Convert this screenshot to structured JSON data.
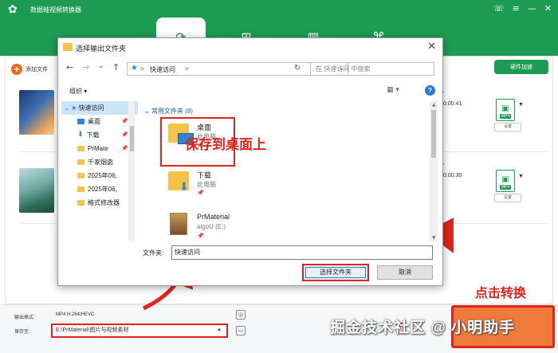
{
  "app": {
    "title": "数据蛙视频转换器",
    "logo_icon": "✿",
    "window_controls": [
      "☏",
      "≡",
      "—",
      "✕"
    ],
    "tabs": [
      {
        "name": "convert",
        "icon": "⟳"
      },
      {
        "name": "edit",
        "icon": "⊞"
      },
      {
        "name": "layout",
        "icon": "▥"
      },
      {
        "name": "toolbox",
        "icon": "⌘"
      }
    ],
    "add_file_label": "添加文件",
    "hw_accel_label": "硬件加速",
    "rows": [
      {
        "duration": "00:00:41",
        "format_tag": "MP4",
        "settings_label": "设置"
      },
      {
        "duration": "00:00:30",
        "format_tag": "MP4",
        "settings_label": "设置"
      }
    ],
    "colors": {
      "accent": "#1e9b52",
      "orange": "#f06a1e",
      "annotation_red": "#e0231c"
    }
  },
  "bottom": {
    "output_format_label": "输出格式:",
    "output_format_value": "MP4 H.264/HEVC",
    "save_to_label": "保存至:",
    "save_to_value": "E:\\PrMaterial\\图片与视频素材",
    "save_dropdown": "▼"
  },
  "annotations": {
    "save_desktop": "保存到桌面上",
    "click_convert": "点击转换",
    "watermark": "掘金技术社区 @ 小明助手"
  },
  "dialog": {
    "title": "选择输出文件夹",
    "close": "✕",
    "nav": {
      "back": "←",
      "forward": "→",
      "down": "⌄",
      "up": "↑"
    },
    "address": {
      "star": "★",
      "sep1": ">",
      "crumb": "快速访问",
      "sep2": ">",
      "dropdown": "⌄"
    },
    "refresh": "↻",
    "search_placeholder": "在 快速访问 中搜索",
    "organize": "组织 ▾",
    "view": "▦ ▾",
    "help": "?",
    "nav_pane": [
      {
        "label": "快速访问",
        "icon": "star",
        "selected": true
      },
      {
        "label": "桌面",
        "icon": "desktop",
        "pinned": true
      },
      {
        "label": "下载",
        "icon": "download",
        "pinned": true
      },
      {
        "label": "PrMate",
        "icon": "folder",
        "pinned": true
      },
      {
        "label": "千家烟囱",
        "icon": "folder"
      },
      {
        "label": "2025年06,",
        "icon": "folder"
      },
      {
        "label": "2025年06,",
        "icon": "folder"
      },
      {
        "label": "格式修改器",
        "icon": "folder"
      }
    ],
    "group_header": "常用文件夹 (8)",
    "items": [
      {
        "name": "桌面",
        "sub": "此电脑",
        "pin": "📌"
      },
      {
        "name": "下载",
        "sub": "此电脑",
        "pin": "📌"
      },
      {
        "name": "PrMaterial",
        "sub": "aigoU (E:)",
        "pin": "📌"
      }
    ],
    "folder_label": "文件夹:",
    "folder_value": "快速访问",
    "select_button": "选择文件夹",
    "cancel_button": "取消"
  }
}
